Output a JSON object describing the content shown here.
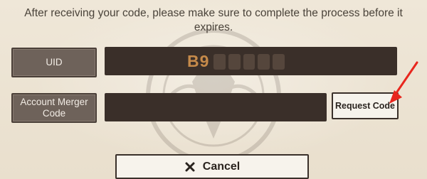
{
  "instruction_text": "After receiving your code, please make sure to complete the process before it expires.",
  "uid": {
    "label": "UID",
    "value": "B9"
  },
  "merger": {
    "label": "Account Merger Code",
    "value": "",
    "request_button_label": "Request Code"
  },
  "actions": {
    "cancel_label": "Cancel"
  },
  "icons": {
    "cancel": "close-icon",
    "annotation": "red-arrow"
  },
  "colors": {
    "background": "#ece3d3",
    "field_dark": "#3a2f29",
    "label_bg": "#6e625a",
    "uid_text": "#c58a4a",
    "arrow_red": "#e8261d"
  }
}
